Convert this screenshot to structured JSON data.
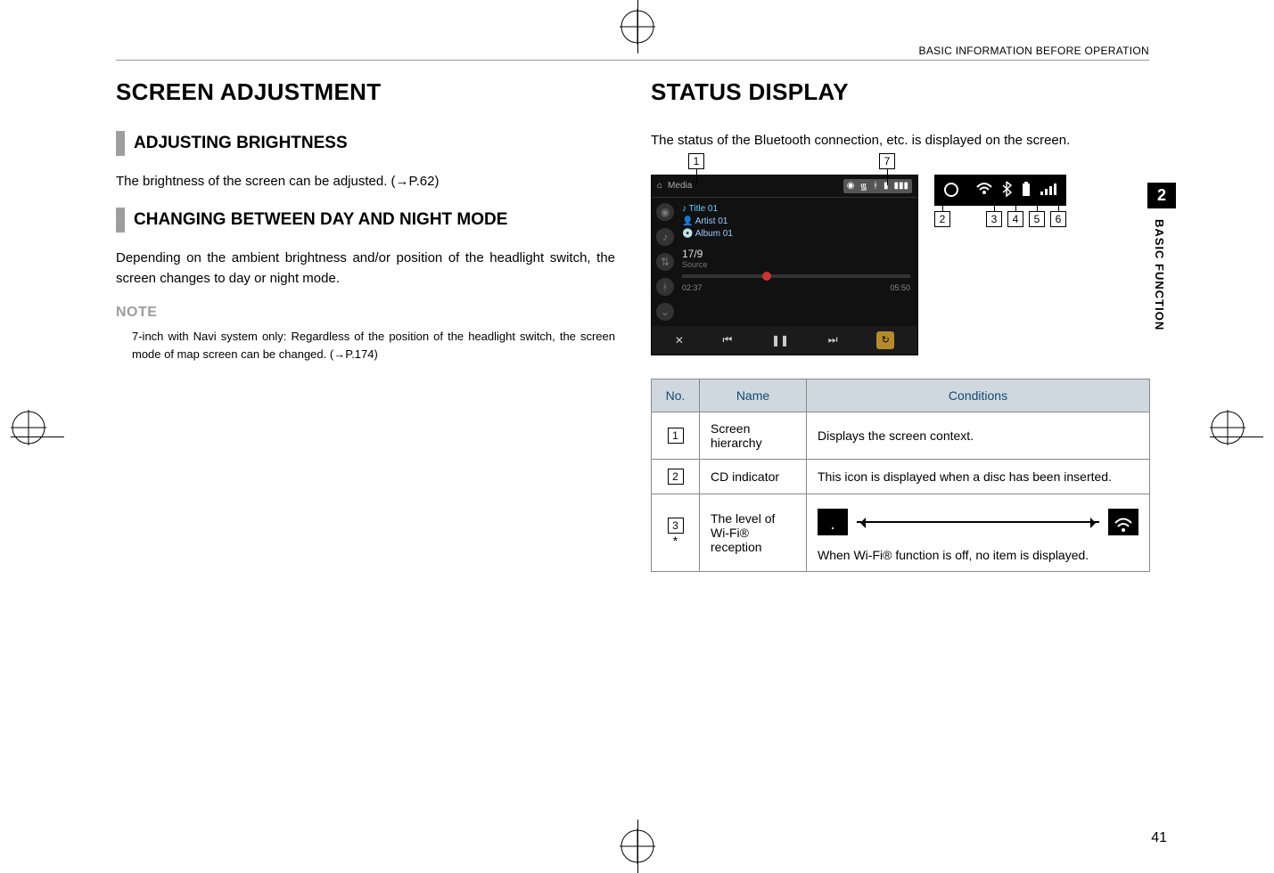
{
  "running_head": "BASIC INFORMATION BEFORE OPERATION",
  "left": {
    "h1": "SCREEN ADJUSTMENT",
    "sec1_title": "ADJUSTING BRIGHTNESS",
    "sec1_body": "The brightness of the screen can be adjusted. (→P.62)",
    "sec2_title": "CHANGING BETWEEN DAY AND NIGHT MODE",
    "sec2_body": "Depending on the ambient brightness and/or position of the headlight switch, the screen changes to day or night mode.",
    "note_head": "NOTE",
    "note_body": "7-inch with Navi system only: Regardless of the position of the headlight switch, the screen mode of map screen can be changed. (→P.174)"
  },
  "right": {
    "h1": "STATUS DISPLAY",
    "intro": "The status of the Bluetooth connection, etc. is displayed on the screen.",
    "callouts_top": {
      "one": "1",
      "seven": "7"
    },
    "shot": {
      "crumb": "Media",
      "title": "Title 01",
      "artist": "Artist 01",
      "album": "Album 01",
      "track": "17/9",
      "source": "Source",
      "t_cur": "02:37",
      "t_tot": "05:50"
    },
    "zoom": {
      "two": "2",
      "three": "3",
      "four": "4",
      "five": "5",
      "six": "6"
    },
    "table": {
      "head_no": "No.",
      "head_name": "Name",
      "head_cond": "Conditions",
      "rows": [
        {
          "num": "1",
          "name": "Screen hierarchy",
          "cond": "Displays the screen context."
        },
        {
          "num": "2",
          "name": "CD indicator",
          "cond": "This icon is displayed when a disc has been inserted."
        },
        {
          "num": "3",
          "num_suffix": "*",
          "name": "The level of Wi-Fi® reception",
          "cond_tail": "When Wi-Fi® function is off, no item is displayed."
        }
      ]
    }
  },
  "side": {
    "chapter": "2",
    "label": "BASIC FUNCTION"
  },
  "page_number": "41",
  "icons": {
    "home": "⌂",
    "wifi_weak": ".",
    "wifi_full": "⧔",
    "bt": "✱",
    "batt": "▮",
    "sig": "▮▯▮",
    "prev": "⏮",
    "pause": "❚❚",
    "next": "⏭",
    "shuffle": "✕",
    "repeat": "↻",
    "disc": "◉"
  }
}
